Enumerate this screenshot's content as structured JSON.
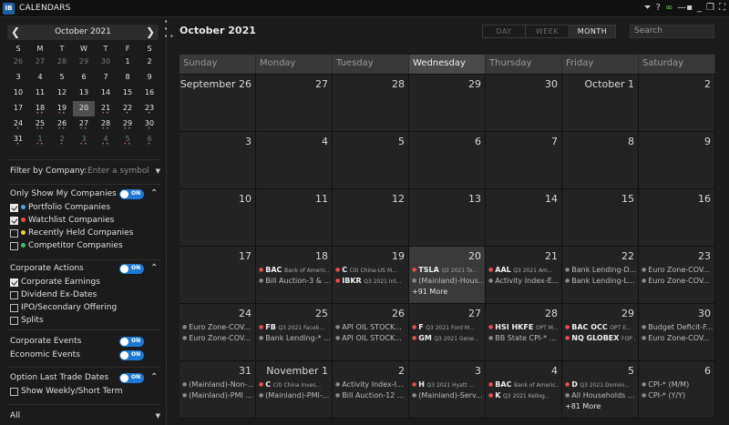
{
  "titlebar": {
    "app_icon": "IB",
    "title": "CALENDARS",
    "icons": [
      "filter-icon",
      "help-icon",
      "link-icon",
      "lock-icon",
      "minimize-icon",
      "restore-icon",
      "maximize-icon"
    ]
  },
  "mini_calendar": {
    "title": "October 2021",
    "prev": "❮",
    "next": "❯",
    "dow": [
      "S",
      "M",
      "T",
      "W",
      "T",
      "F",
      "S"
    ],
    "days": [
      {
        "d": "26",
        "m": true
      },
      {
        "d": "27",
        "m": true
      },
      {
        "d": "28",
        "m": true
      },
      {
        "d": "29",
        "m": true
      },
      {
        "d": "30",
        "m": true
      },
      {
        "d": "1"
      },
      {
        "d": "2"
      },
      {
        "d": "3"
      },
      {
        "d": "4"
      },
      {
        "d": "5"
      },
      {
        "d": "6"
      },
      {
        "d": "7"
      },
      {
        "d": "8"
      },
      {
        "d": "9"
      },
      {
        "d": "10"
      },
      {
        "d": "11"
      },
      {
        "d": "12"
      },
      {
        "d": "13"
      },
      {
        "d": "14"
      },
      {
        "d": "15"
      },
      {
        "d": "16"
      },
      {
        "d": "17"
      },
      {
        "d": "18",
        "dots": "red-grey"
      },
      {
        "d": "19",
        "dots": "red-grey"
      },
      {
        "d": "20",
        "today": true
      },
      {
        "d": "21",
        "dots": "red-grey"
      },
      {
        "d": "22",
        "dots": "grey"
      },
      {
        "d": "23",
        "dots": "grey"
      },
      {
        "d": "24",
        "dots": "grey"
      },
      {
        "d": "25",
        "dots": "red-grey"
      },
      {
        "d": "26",
        "dots": "red-grey"
      },
      {
        "d": "27",
        "dots": "red-grey"
      },
      {
        "d": "28",
        "dots": "red-grey"
      },
      {
        "d": "29",
        "dots": "red-grey"
      },
      {
        "d": "30",
        "dots": "grey"
      },
      {
        "d": "31",
        "dots": "grey"
      },
      {
        "d": "1",
        "m": true,
        "dots": "red-grey"
      },
      {
        "d": "2",
        "m": true,
        "dots": "grey"
      },
      {
        "d": "3",
        "m": true,
        "dots": "red-grey"
      },
      {
        "d": "4",
        "m": true,
        "dots": "red-grey"
      },
      {
        "d": "5",
        "m": true,
        "dots": "red-grey"
      },
      {
        "d": "6",
        "m": true,
        "dots": "grey"
      }
    ]
  },
  "filter": {
    "label": "Filter by Company:",
    "placeholder": "Enter a symbol"
  },
  "only_show_mine": {
    "label": "Only Show My Companies",
    "toggle": "ON"
  },
  "companies": [
    {
      "label": "Portfolio Companies",
      "checked": true,
      "color": "#4fa3e8"
    },
    {
      "label": "Watchlist Companies",
      "checked": true,
      "color": "#e94f4f"
    },
    {
      "label": "Recently Held Companies",
      "checked": false,
      "color": "#e8d43a"
    },
    {
      "label": "Competitor Companies",
      "checked": false,
      "color": "#3fbf6a"
    }
  ],
  "corporate_actions": {
    "label": "Corporate Actions",
    "toggle": "ON"
  },
  "actions": [
    {
      "label": "Corporate Earnings",
      "checked": true
    },
    {
      "label": "Dividend Ex-Dates",
      "checked": false
    },
    {
      "label": "IPO/Secondary Offering",
      "checked": false
    },
    {
      "label": "Splits",
      "checked": false
    }
  ],
  "corporate_events": {
    "label": "Corporate Events",
    "toggle": "ON"
  },
  "economic_events": {
    "label": "Economic Events",
    "toggle": "ON"
  },
  "option_last_trade": {
    "label": "Option Last Trade Dates",
    "toggle": "ON"
  },
  "show_weekly": {
    "label": "Show Weekly/Short Term",
    "checked": false
  },
  "bottom_select": {
    "value": "All"
  },
  "main": {
    "title": "October 2021",
    "views": [
      {
        "label": "DAY",
        "active": false,
        "w": 47
      },
      {
        "label": "WEEK",
        "active": false,
        "w": 48
      },
      {
        "label": "MONTH",
        "active": true,
        "w": 50
      }
    ],
    "search_placeholder": "Search",
    "dow": [
      "Sunday",
      "Monday",
      "Tuesday",
      "Wednesday",
      "Thursday",
      "Friday",
      "Saturday"
    ],
    "active_dow": 3,
    "cells": [
      {
        "num": "September 26"
      },
      {
        "num": "27"
      },
      {
        "num": "28"
      },
      {
        "num": "29"
      },
      {
        "num": "30"
      },
      {
        "num": "October 1"
      },
      {
        "num": "2"
      },
      {
        "num": "3"
      },
      {
        "num": "4"
      },
      {
        "num": "5"
      },
      {
        "num": "6"
      },
      {
        "num": "7"
      },
      {
        "num": "8"
      },
      {
        "num": "9"
      },
      {
        "num": "10"
      },
      {
        "num": "11"
      },
      {
        "num": "12"
      },
      {
        "num": "13"
      },
      {
        "num": "14"
      },
      {
        "num": "15"
      },
      {
        "num": "16"
      },
      {
        "num": "17"
      },
      {
        "num": "18",
        "events": [
          {
            "b": "red",
            "tk": "BAC",
            "sub": "Bank of Americ..."
          },
          {
            "b": "grey",
            "text": "Bill Auction-3 & ..."
          }
        ]
      },
      {
        "num": "19",
        "events": [
          {
            "b": "red",
            "tk": "C",
            "sub": "Citi China-US M..."
          },
          {
            "b": "red",
            "tk": "IBKR",
            "sub": "Q3 2021 Int..."
          }
        ]
      },
      {
        "num": "20",
        "highlight": true,
        "events": [
          {
            "b": "red",
            "tk": "TSLA",
            "sub": "Q3 2021 Te..."
          },
          {
            "b": "grey",
            "text": "(Mainland)-Hous..."
          }
        ],
        "more": "+91 More"
      },
      {
        "num": "21",
        "events": [
          {
            "b": "red",
            "tk": "AAL",
            "sub": "Q3 2021 Am..."
          },
          {
            "b": "grey",
            "text": "Activity Index-E..."
          }
        ]
      },
      {
        "num": "22",
        "events": [
          {
            "b": "grey",
            "text": "Bank Lending-D..."
          },
          {
            "b": "grey",
            "text": "Bank Lending-L..."
          }
        ]
      },
      {
        "num": "23",
        "events": [
          {
            "b": "grey",
            "text": "Euro Zone-COV..."
          },
          {
            "b": "grey",
            "text": "Euro Zone-COV..."
          }
        ]
      },
      {
        "num": "24",
        "events": [
          {
            "b": "grey",
            "text": "Euro Zone-COV..."
          },
          {
            "b": "grey",
            "text": "Euro Zone-COV..."
          }
        ]
      },
      {
        "num": "25",
        "events": [
          {
            "b": "red",
            "tk": "FB",
            "sub": "Q3 2021 Faceb..."
          },
          {
            "b": "grey",
            "text": "Bank Lending-* ..."
          }
        ]
      },
      {
        "num": "26",
        "events": [
          {
            "b": "grey",
            "text": "API OIL STOCK..."
          },
          {
            "b": "grey",
            "text": "API OIL STOCK..."
          }
        ]
      },
      {
        "num": "27",
        "events": [
          {
            "b": "red",
            "tk": "F",
            "sub": "Q3 2021 Ford M..."
          },
          {
            "b": "red",
            "tk": "GM",
            "sub": "Q3 2021 Gene..."
          }
        ]
      },
      {
        "num": "28",
        "events": [
          {
            "b": "red",
            "tk": "HSI HKFE",
            "sub": "OPT M..."
          },
          {
            "b": "grey",
            "text": "BB State CPI-* ..."
          }
        ]
      },
      {
        "num": "29",
        "events": [
          {
            "b": "red",
            "tk": "BAC OCC",
            "sub": "OPT E..."
          },
          {
            "b": "red",
            "tk": "NQ GLOBEX",
            "sub": "FOP ..."
          }
        ]
      },
      {
        "num": "30",
        "events": [
          {
            "b": "grey",
            "text": "Budget Deficit-F..."
          },
          {
            "b": "grey",
            "text": "Euro Zone-COV..."
          }
        ]
      },
      {
        "num": "31",
        "events": [
          {
            "b": "grey",
            "text": "(Mainland)-Non-..."
          },
          {
            "b": "grey",
            "text": "(Mainland)-PMI ..."
          }
        ]
      },
      {
        "num": "November 1",
        "events": [
          {
            "b": "red",
            "tk": "C",
            "sub": "Citi China Inves..."
          },
          {
            "b": "grey",
            "text": "(Mainland)-PMI-..."
          }
        ]
      },
      {
        "num": "2",
        "events": [
          {
            "b": "grey",
            "text": "Activity Index-I..."
          },
          {
            "b": "grey",
            "text": "Bill Auction-12 ..."
          }
        ]
      },
      {
        "num": "3",
        "events": [
          {
            "b": "red",
            "tk": "H",
            "sub": "Q3 2021 Hyatt ..."
          },
          {
            "b": "grey",
            "text": "(Mainland)-Serv..."
          }
        ]
      },
      {
        "num": "4",
        "events": [
          {
            "b": "red",
            "tk": "BAC",
            "sub": "Bank of Americ..."
          },
          {
            "b": "red",
            "tk": "K",
            "sub": "Q3 2021 Kellog..."
          }
        ]
      },
      {
        "num": "5",
        "events": [
          {
            "b": "red",
            "tk": "D",
            "sub": "Q3 2021 Domini..."
          },
          {
            "b": "grey",
            "text": "All Households ..."
          }
        ],
        "more": "+81 More"
      },
      {
        "num": "6",
        "events": [
          {
            "b": "grey",
            "text": "CPI-* (M/M)"
          },
          {
            "b": "grey",
            "text": "CPI-* (Y/Y)"
          }
        ]
      }
    ]
  }
}
